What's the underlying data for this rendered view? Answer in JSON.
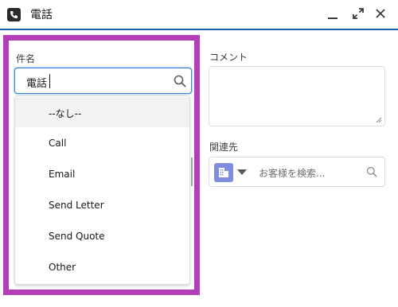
{
  "header": {
    "title": "電話",
    "icons": {
      "app": "phone-icon",
      "minimize": "minimize-icon",
      "expand": "expand-icon",
      "close": "close-icon"
    }
  },
  "subject": {
    "label": "件名",
    "value": "電話",
    "options": [
      "--なし--",
      "Call",
      "Email",
      "Send Letter",
      "Send Quote",
      "Other"
    ],
    "highlighted_index": 0
  },
  "comment": {
    "label": "コメント",
    "value": ""
  },
  "related": {
    "label": "関連先",
    "placeholder": "お客様を検索...",
    "object_icon": "account-icon"
  },
  "colors": {
    "highlight_border": "#b23fb8",
    "focus_blue": "#3b84d6",
    "header_line": "#1b5eab",
    "object_icon_bg": "#7f8de1"
  }
}
